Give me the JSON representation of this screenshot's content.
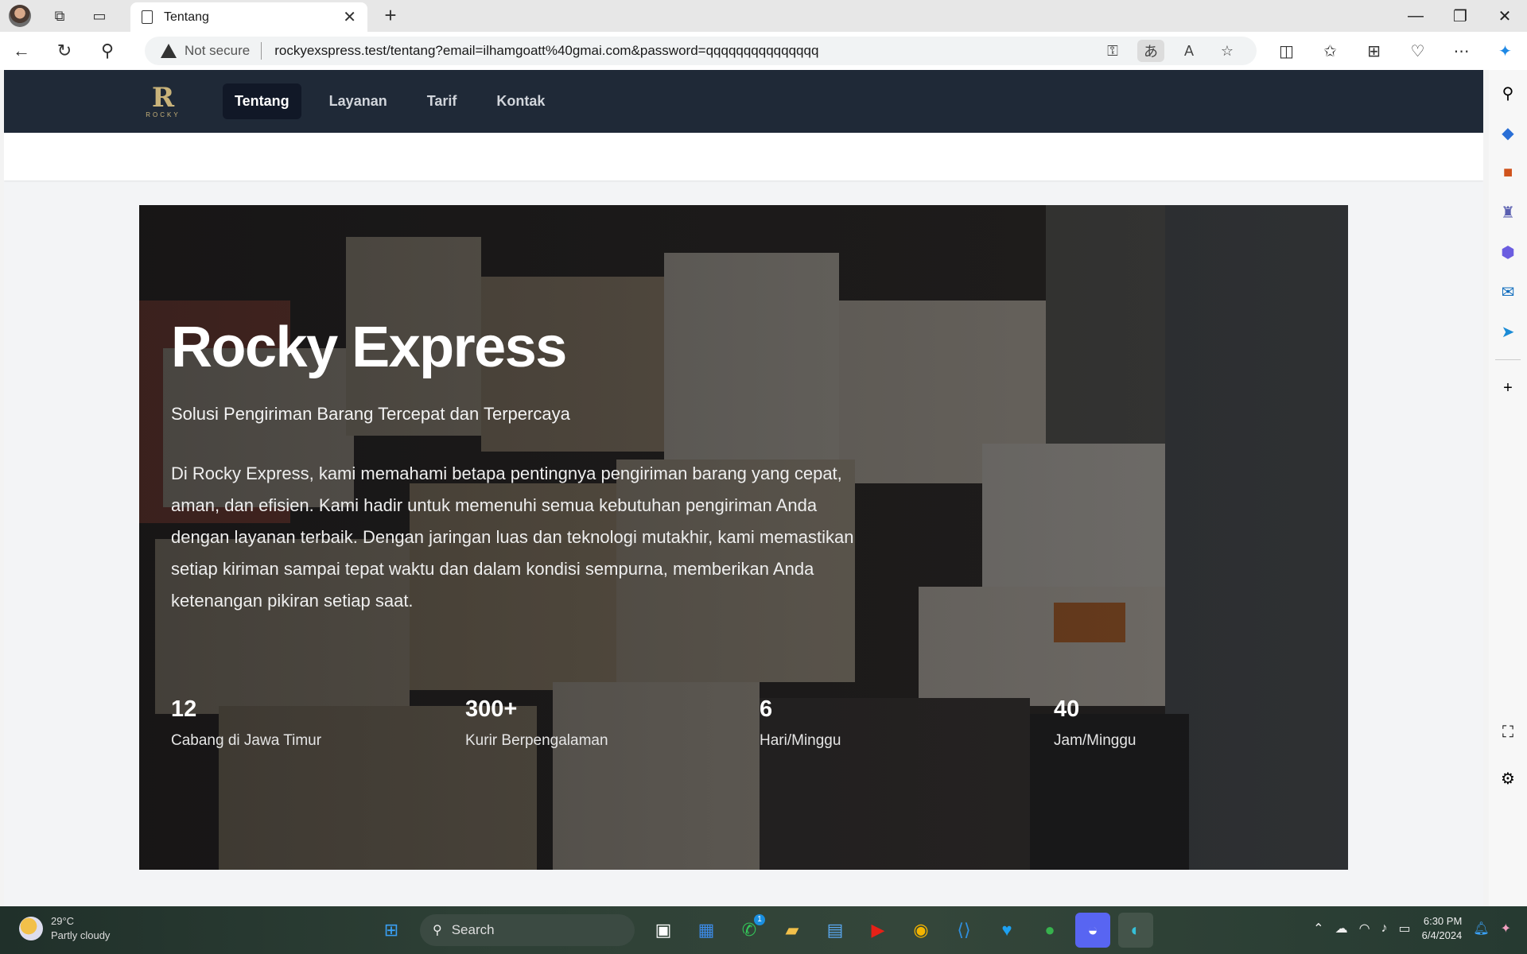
{
  "browser": {
    "tab_title": "Tentang",
    "security_label": "Not secure",
    "url": "rockyexspress.test/tentang?email=ilhamgoatt%40gmai.com&password=qqqqqqqqqqqqqqq"
  },
  "site": {
    "logo_text": "ROCKY",
    "nav": [
      {
        "label": "Tentang"
      },
      {
        "label": "Layanan"
      },
      {
        "label": "Tarif"
      },
      {
        "label": "Kontak"
      }
    ]
  },
  "hero": {
    "title": "Rocky Express",
    "subtitle": "Solusi Pengiriman Barang Tercepat dan Terpercaya",
    "body": "Di Rocky Express, kami memahami betapa pentingnya pengiriman barang yang cepat, aman, dan efisien. Kami hadir untuk memenuhi semua kebutuhan pengiriman Anda dengan layanan terbaik. Dengan jaringan luas dan teknologi mutakhir, kami memastikan setiap kiriman sampai tepat waktu dan dalam kondisi sempurna, memberikan Anda ketenangan pikiran setiap saat.",
    "stats": [
      {
        "value": "12",
        "label": "Cabang di Jawa Timur"
      },
      {
        "value": "300+",
        "label": "Kurir Berpengalaman"
      },
      {
        "value": "6",
        "label": "Hari/Minggu"
      },
      {
        "value": "40",
        "label": "Jam/Minggu"
      }
    ]
  },
  "taskbar": {
    "weather_temp": "29°C",
    "weather_desc": "Partly cloudy",
    "search_label": "Search",
    "whatsapp_badge": "1",
    "time": "6:30 PM",
    "date": "6/4/2024"
  },
  "colors": {
    "site_nav_bg": "#1f2937",
    "nav_active_bg": "#111827",
    "logo_gold": "#c9b37a"
  }
}
